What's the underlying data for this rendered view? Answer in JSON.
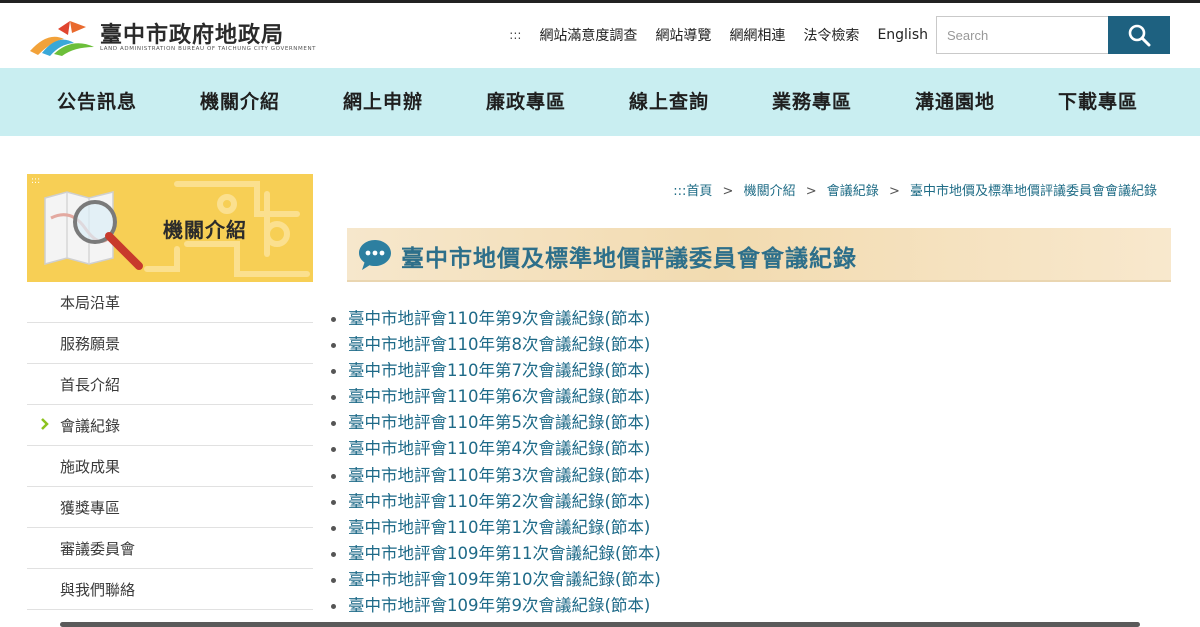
{
  "header": {
    "logo_title": "臺中市政府地政局",
    "logo_subtitle": "LAND ADMINISTRATION BUREAU OF TAICHUNG CITY GOVERNMENT",
    "accesskey": ":::",
    "links": [
      "網站滿意度調查",
      "網站導覽",
      "網網相連",
      "法令檢索",
      "English"
    ],
    "search_placeholder": "Search"
  },
  "nav": {
    "items": [
      "公告訊息",
      "機關介紹",
      "網上申辦",
      "廉政專區",
      "線上查詢",
      "業務專區",
      "溝通園地",
      "下載專區"
    ]
  },
  "sidebar": {
    "accesskey": ":::",
    "banner_title": "機關介紹",
    "items": [
      "本局沿革",
      "服務願景",
      "首長介紹",
      "會議紀錄",
      "施政成果",
      "獲獎專區",
      "審議委員會",
      "與我們聯絡"
    ],
    "active_index": 3
  },
  "breadcrumb": {
    "accesskey": ":::",
    "items": [
      "首頁",
      "機關介紹",
      "會議紀錄",
      "臺中市地價及標準地價評議委員會會議紀錄"
    ],
    "separator": ">"
  },
  "content": {
    "title": "臺中市地價及標準地價評議委員會會議紀錄",
    "records": [
      "臺中市地評會110年第9次會議紀錄(節本)",
      "臺中市地評會110年第8次會議紀錄(節本)",
      "臺中市地評會110年第7次會議紀錄(節本)",
      "臺中市地評會110年第6次會議紀錄(節本)",
      "臺中市地評會110年第5次會議紀錄(節本)",
      "臺中市地評會110年第4次會議紀錄(節本)",
      "臺中市地評會110年第3次會議紀錄(節本)",
      "臺中市地評會110年第2次會議紀錄(節本)",
      "臺中市地評會110年第1次會議紀錄(節本)",
      "臺中市地評會109年第11次會議紀錄(節本)",
      "臺中市地評會109年第10次會議紀錄(節本)",
      "臺中市地評會109年第9次會議紀錄(節本)"
    ]
  },
  "colors": {
    "nav_bg": "#c9eef1",
    "search_button": "#1e6180",
    "banner_bg": "#f7cf55",
    "link": "#1e6a88",
    "active_chevron": "#8dc21f"
  },
  "icons": {
    "search": "magnifier-icon",
    "banner": "map-magnifier-icon",
    "heading": "speech-bubble-icon",
    "active": "chevron-right-icon"
  }
}
